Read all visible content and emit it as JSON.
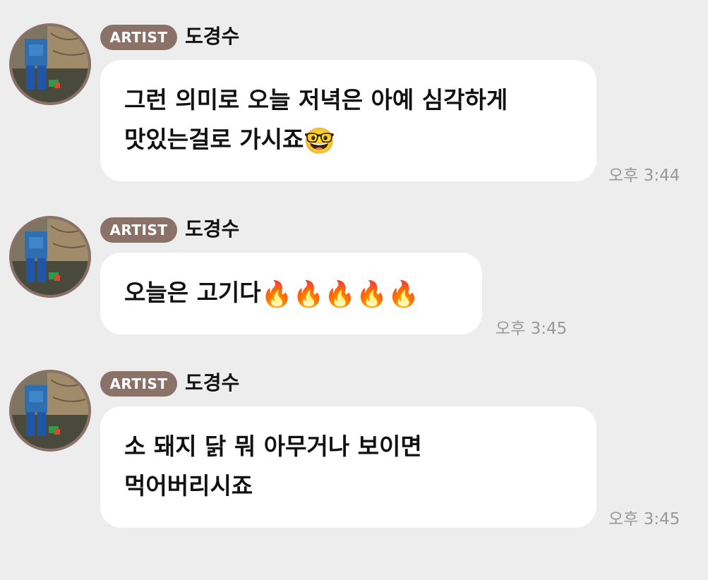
{
  "messages": [
    {
      "badge": "ARTIST",
      "sender": "도경수",
      "text": "그런 의미로 오늘 저녁은 아예 심각하게\n맛있는걸로 가시죠",
      "emoji": "🤓",
      "time": "오후 3:44"
    },
    {
      "badge": "ARTIST",
      "sender": "도경수",
      "text": "오늘은 고기다",
      "emoji": "🔥🔥🔥🔥🔥",
      "time": "오후 3:45"
    },
    {
      "badge": "ARTIST",
      "sender": "도경수",
      "text": "소 돼지 닭 뭐 아무거나 보이면\n먹어버리시죠",
      "emoji": "",
      "time": "오후 3:45"
    }
  ],
  "colors": {
    "background": "#ededed",
    "bubble": "#ffffff",
    "badge": "#8a7268",
    "time": "#999999"
  },
  "icons": {
    "avatar": "profile-photo"
  }
}
